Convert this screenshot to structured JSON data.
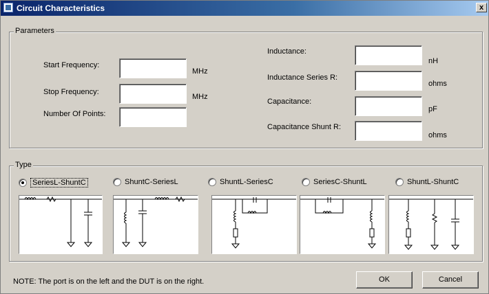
{
  "window": {
    "title": "Circuit Characteristics",
    "close_glyph": "x"
  },
  "parameters": {
    "group_label": "Parameters",
    "start_frequency": {
      "label": "Start Frequency:",
      "value": "",
      "unit": "MHz"
    },
    "stop_frequency": {
      "label": "Stop Frequency:",
      "value": "",
      "unit": "MHz"
    },
    "number_of_points": {
      "label": "Number Of Points:",
      "value": ""
    },
    "inductance": {
      "label": "Inductance:",
      "value": "",
      "unit": "nH"
    },
    "inductance_series_r": {
      "label": "Inductance Series R:",
      "value": "",
      "unit": "ohms"
    },
    "capacitance": {
      "label": "Capacitance:",
      "value": "",
      "unit": "pF"
    },
    "capacitance_shunt_r": {
      "label": "Capacitance Shunt R:",
      "value": "",
      "unit": "ohms"
    }
  },
  "type": {
    "group_label": "Type",
    "selected": "SeriesL-ShuntC",
    "options": [
      {
        "label": "SeriesL-ShuntC",
        "checked": true
      },
      {
        "label": "ShuntC-SeriesL",
        "checked": false
      },
      {
        "label": "ShuntL-SeriesC",
        "checked": false
      },
      {
        "label": "SeriesC-ShuntL",
        "checked": false
      },
      {
        "label": "ShuntL-ShuntC",
        "checked": false
      }
    ]
  },
  "footer": {
    "note": "NOTE:  The port is on the left and the DUT is on the right.",
    "ok_label": "OK",
    "cancel_label": "Cancel"
  }
}
